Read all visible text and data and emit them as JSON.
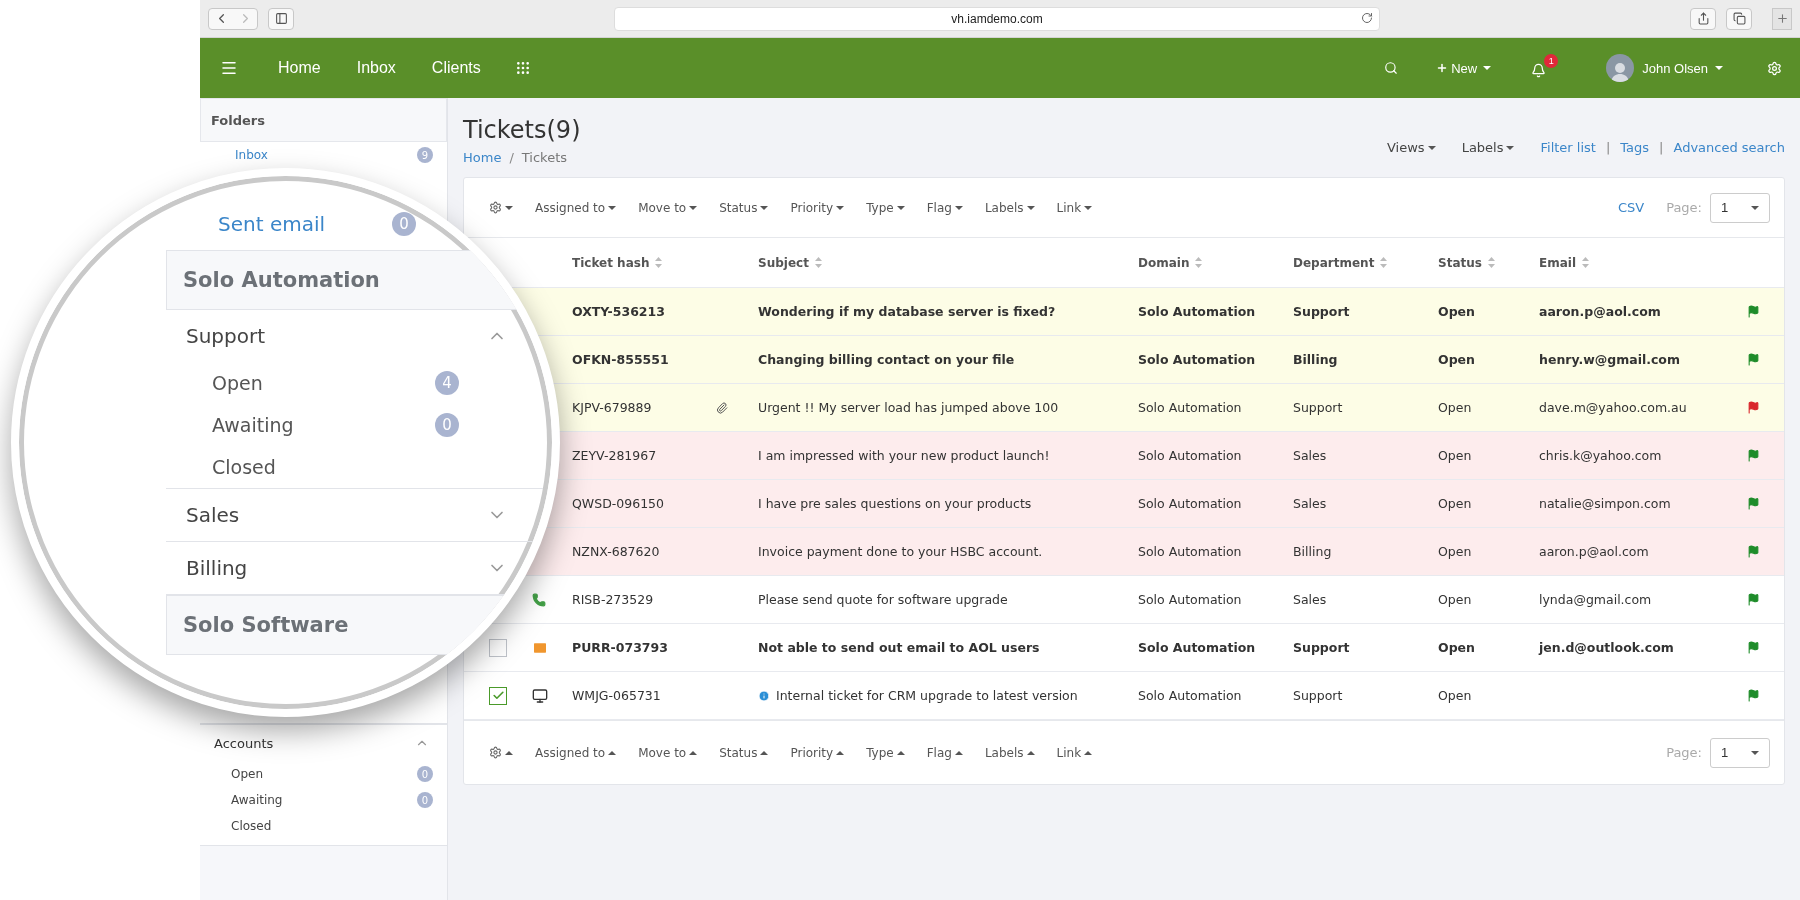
{
  "browser": {
    "url": "vh.iamdemo.com"
  },
  "navbar": {
    "links": [
      {
        "label": "Home"
      },
      {
        "label": "Inbox"
      },
      {
        "label": "Clients"
      }
    ],
    "new_label": "New",
    "notifications": "1",
    "user": "John Olsen"
  },
  "sidebar": {
    "title": "Folders",
    "folders": [
      {
        "label": "Inbox",
        "count": "9"
      }
    ],
    "groups": [
      {
        "title": "Accounts",
        "expanded": true,
        "items": [
          {
            "label": "Open",
            "count": "0"
          },
          {
            "label": "Awaiting",
            "count": "0"
          },
          {
            "label": "Closed"
          }
        ]
      }
    ]
  },
  "magnifier": {
    "folders": [
      {
        "label": "Sent email",
        "count": "0"
      }
    ],
    "sections": [
      {
        "title": "Solo Automation",
        "groups": [
          {
            "title": "Support",
            "expanded": true,
            "items": [
              {
                "label": "Open",
                "count": "4"
              },
              {
                "label": "Awaiting",
                "count": "0"
              },
              {
                "label": "Closed"
              }
            ]
          },
          {
            "title": "Sales",
            "expanded": false
          },
          {
            "title": "Billing",
            "expanded": false
          }
        ]
      },
      {
        "title": "Solo Software"
      }
    ]
  },
  "page": {
    "title": "Tickets(9)",
    "breadcrumb": [
      "Home",
      "Tickets"
    ],
    "breadcrumb_separator": "/",
    "menus": [
      "Views",
      "Labels"
    ],
    "links": [
      "Filter list",
      "Tags",
      "Advanced search"
    ],
    "link_separators": [
      "|",
      "|"
    ]
  },
  "table": {
    "actions": [
      "Assigned to",
      "Move to",
      "Status",
      "Priority",
      "Type",
      "Flag",
      "Labels",
      "Link"
    ],
    "csv": "CSV",
    "page_label": "Page:",
    "page": "1",
    "columns": [
      "Ticket hash",
      "Subject",
      "Domain",
      "Department",
      "Status",
      "Email"
    ],
    "rows": [
      {
        "kind": "warning",
        "hash": "OXTY-536213",
        "subject": "Wondering if my database server is fixed?",
        "domain": "Solo Automation",
        "department": "Support",
        "status": "Open",
        "email": "aaron.p@aol.com",
        "unread": true,
        "attachment": false,
        "info": false,
        "color": "#1e8c2a"
      },
      {
        "kind": "warning",
        "hash": "OFKN-855551",
        "subject": "Changing billing contact on your file",
        "domain": "Solo Automation",
        "department": "Billing",
        "status": "Open",
        "email": "henry.w@gmail.com",
        "unread": true,
        "attachment": false,
        "info": false,
        "color": "#1e8c2a"
      },
      {
        "kind": "warning",
        "hash": "KJPV-679889",
        "subject": "Urgent !! My server load has jumped above 100",
        "domain": "Solo Automation",
        "department": "Support",
        "status": "Open",
        "email": "dave.m@yahoo.com.au",
        "unread": false,
        "attachment": true,
        "info": false,
        "color": "#d9262b"
      },
      {
        "kind": "danger",
        "hash": "ZEYV-281967",
        "subject": "I am impressed with your new product launch!",
        "domain": "Solo Automation",
        "department": "Sales",
        "status": "Open",
        "email": "chris.k@yahoo.com",
        "unread": false,
        "attachment": false,
        "info": false,
        "color": "#1e8c2a"
      },
      {
        "kind": "danger",
        "hash": "QWSD-096150",
        "subject": "I have pre sales questions on your products",
        "domain": "Solo Automation",
        "department": "Sales",
        "status": "Open",
        "email": "natalie@simpon.com",
        "unread": false,
        "attachment": false,
        "info": false,
        "color": "#1e8c2a"
      },
      {
        "kind": "danger",
        "hash": "NZNX-687620",
        "subject": "Invoice payment done to your HSBC account.",
        "domain": "Solo Automation",
        "department": "Billing",
        "status": "Open",
        "email": "aaron.p@aol.com",
        "unread": false,
        "attachment": false,
        "info": false,
        "color": "#1e8c2a"
      },
      {
        "kind": "plain",
        "hash": "RISB-273529",
        "subject": "Please send quote for software upgrade",
        "domain": "Solo Automation",
        "department": "Sales",
        "status": "Open",
        "email": "lynda@gmail.com",
        "unread": false,
        "attachment": false,
        "info": false,
        "color": "#1e8c2a",
        "channel": {
          "kind": "phone"
        }
      },
      {
        "kind": "plain",
        "hash": "PURR-073793",
        "subject": "Not able to send out email to AOL users",
        "domain": "Solo Automation",
        "department": "Support",
        "status": "Open",
        "email": "jen.d@outlook.com",
        "unread": true,
        "attachment": false,
        "info": false,
        "color": "#1e8c2a",
        "channel": {
          "kind": "email"
        },
        "checked": false
      },
      {
        "kind": "plain",
        "hash": "WMJG-065731",
        "subject": "Internal ticket for CRM upgrade to latest version",
        "domain": "Solo Automation",
        "department": "Support",
        "status": "Open",
        "unread": false,
        "attachment": false,
        "info": true,
        "color": "#1e8c2a",
        "channel": {
          "kind": "monitor"
        },
        "checked": true
      }
    ],
    "footer_actions": [
      "Assigned to",
      "Move to",
      "Status",
      "Priority",
      "Type",
      "Flag",
      "Labels",
      "Link"
    ],
    "footer_page_label": "Page:",
    "footer_page": "1"
  }
}
